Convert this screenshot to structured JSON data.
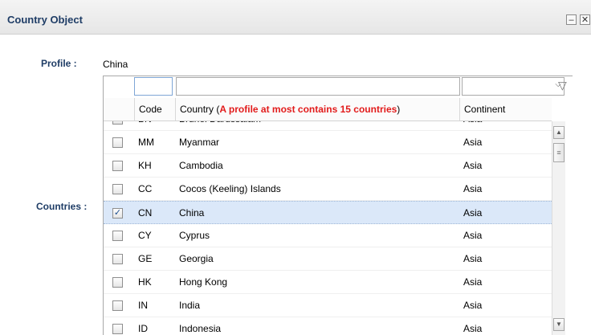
{
  "window": {
    "title": "Country Object",
    "minimize_icon": "minimize-icon",
    "close_icon": "close-icon"
  },
  "profile": {
    "label": "Profile :",
    "value": "China"
  },
  "countries_label": "Countries :",
  "filter": {
    "code_value": "",
    "country_value": "",
    "continent_value": "",
    "filter_icon": "funnel-icon"
  },
  "headers": {
    "code": "Code",
    "country_prefix": "Country (",
    "country_warning": "A profile at most contains 15 countries",
    "country_suffix": ")",
    "continent": "Continent"
  },
  "rows": [
    {
      "code": "BN",
      "country": "Brunei Darussalam",
      "continent": "Asia",
      "checked": false
    },
    {
      "code": "MM",
      "country": "Myanmar",
      "continent": "Asia",
      "checked": false
    },
    {
      "code": "KH",
      "country": "Cambodia",
      "continent": "Asia",
      "checked": false
    },
    {
      "code": "CC",
      "country": "Cocos (Keeling) Islands",
      "continent": "Asia",
      "checked": false
    },
    {
      "code": "CN",
      "country": "China",
      "continent": "Asia",
      "checked": true
    },
    {
      "code": "CY",
      "country": "Cyprus",
      "continent": "Asia",
      "checked": false
    },
    {
      "code": "GE",
      "country": "Georgia",
      "continent": "Asia",
      "checked": false
    },
    {
      "code": "HK",
      "country": "Hong Kong",
      "continent": "Asia",
      "checked": false
    },
    {
      "code": "IN",
      "country": "India",
      "continent": "Asia",
      "checked": false
    },
    {
      "code": "ID",
      "country": "Indonesia",
      "continent": "Asia",
      "checked": false
    }
  ],
  "colors": {
    "accent": "#1f3d66",
    "warning": "#e21b1b",
    "selection": "#dbe8f9"
  }
}
